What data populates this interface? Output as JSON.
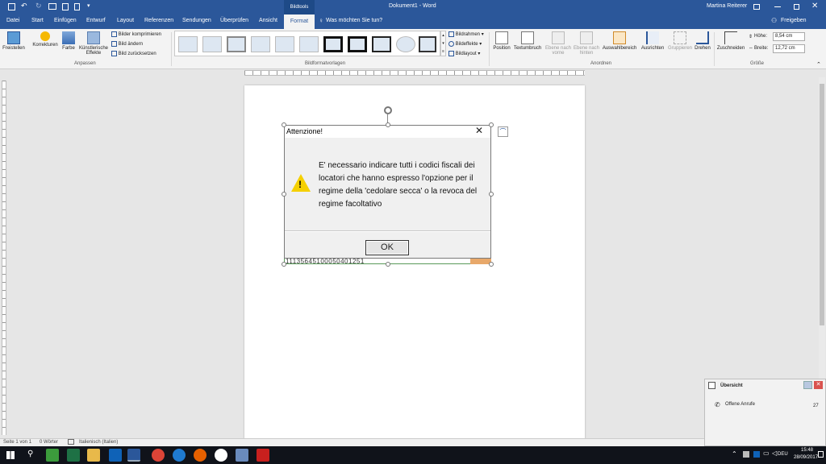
{
  "window": {
    "title": "Dokument1 - Word",
    "context_tab": "Bildtools",
    "user": "Martina Reiterer"
  },
  "tabs": {
    "datei": "Datei",
    "start": "Start",
    "einfuegen": "Einfügen",
    "entwurf": "Entwurf",
    "layout": "Layout",
    "referenzen": "Referenzen",
    "sendungen": "Sendungen",
    "ueberpruefen": "Überprüfen",
    "ansicht": "Ansicht",
    "format": "Format",
    "search": "Was möchten Sie tun?",
    "freigeben": "Freigeben"
  },
  "ribbon": {
    "freistellen": "Freistellen",
    "korrekturen": "Korrekturen",
    "farbe": "Farbe",
    "kuenstlerische": "Künstlerische",
    "effekte": "Effekte",
    "bilder_komprimieren": "Bilder komprimieren",
    "bild_aendern": "Bild ändern",
    "bild_zuruecksetzen": "Bild zurücksetzen",
    "group_anpassen": "Anpassen",
    "bildrahmen": "Bildrahmen",
    "bildeffekte": "Bildeffekte",
    "bildlayout": "Bildlayout",
    "group_bildformatvorlagen": "Bildformatvorlagen",
    "position": "Position",
    "textumbruch": "Textumbruch",
    "ebene_nach_vorne_1": "Ebene nach",
    "ebene_nach_vorne_2": "vorne",
    "ebene_nach_hinten_1": "Ebene nach",
    "ebene_nach_hinten_2": "hinten",
    "auswahlbereich": "Auswahlbereich",
    "ausrichten": "Ausrichten",
    "gruppieren": "Gruppieren",
    "drehen": "Drehen",
    "group_anordnen": "Anordnen",
    "zuschneiden": "Zuschneiden",
    "hoehe_label": "Höhe:",
    "hoehe_value": "8,54 cm",
    "breite_label": "Breite:",
    "breite_value": "12,72 cm",
    "group_groesse": "Größe"
  },
  "dialog": {
    "title": "Attenzione!",
    "message": "E' necessario indicare tutti i codici fiscali dei locatori che hanno espresso l'opzione per il regime della 'cedolare secca' o la revoca del regime facoltativo",
    "ok": "OK",
    "partial_text": "11135645100050401251"
  },
  "status": {
    "page": "Seite 1 von 1",
    "words": "0 Wörter",
    "language": "Italienisch (Italien)"
  },
  "notification": {
    "title": "Übersicht",
    "item": "Offene Anrufe",
    "count": "27"
  },
  "tray": {
    "lang": "DEU",
    "time": "15:48",
    "date": "28/09/2017"
  },
  "colors": {
    "word_blue": "#2b579a",
    "taskbar": "#10131a",
    "warning_yellow": "#f5d000"
  }
}
